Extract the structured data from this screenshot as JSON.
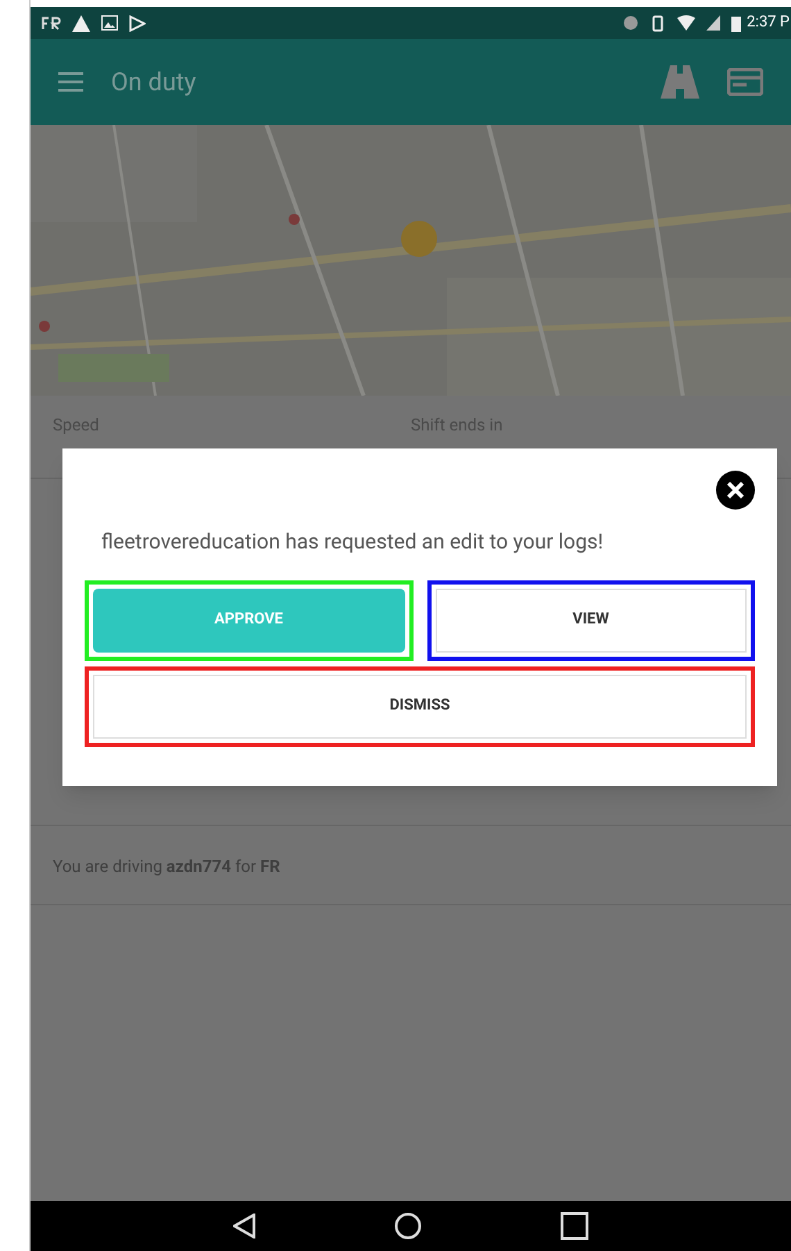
{
  "status_bar": {
    "time": "2:37 P"
  },
  "app_bar": {
    "title": "On duty"
  },
  "stats": [
    {
      "label": "Speed"
    },
    {
      "label": "Shift ends in"
    }
  ],
  "footer": {
    "text": "You are driving **azdn774** for **FR**"
  },
  "dialog": {
    "message": "fleetrovereducation has requested an edit to your logs!",
    "buttons": [
      {
        "label": "APPROVE",
        "kind": "primary",
        "color": "#22ee22"
      },
      {
        "label": "VIEW",
        "kind": "outline",
        "color": "#1111ee"
      },
      {
        "label": "DISMISS",
        "kind": "wide",
        "color": "#ee2222"
      }
    ]
  }
}
